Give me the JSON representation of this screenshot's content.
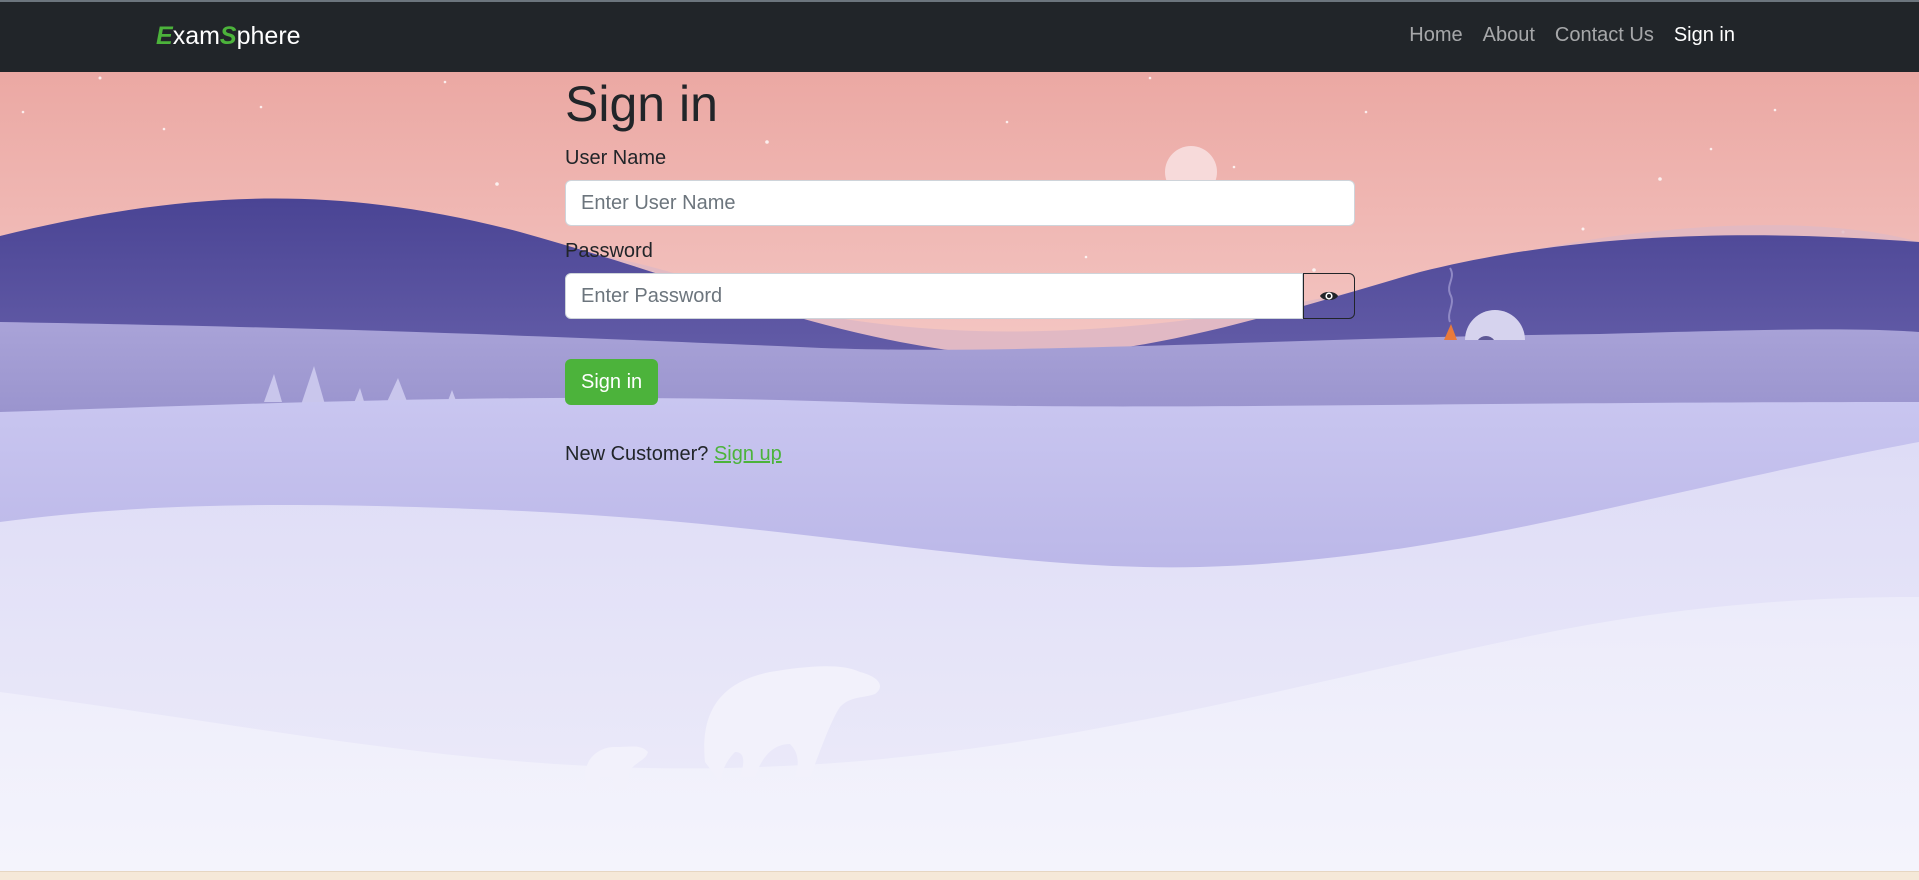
{
  "navbar": {
    "brand": {
      "letter1": "E",
      "part1": "xam",
      "letter2": "S",
      "part2": "phere"
    },
    "links": [
      {
        "label": "Home",
        "active": false
      },
      {
        "label": "About",
        "active": false
      },
      {
        "label": "Contact Us",
        "active": false
      },
      {
        "label": "Sign in",
        "active": true
      }
    ]
  },
  "form": {
    "title": "Sign in",
    "username": {
      "label": "User Name",
      "placeholder": "Enter User Name",
      "value": ""
    },
    "password": {
      "label": "Password",
      "placeholder": "Enter Password",
      "value": ""
    },
    "toggle_icon": "eye-icon",
    "submit_label": "Sign in",
    "new_customer_text": "New Customer?",
    "signup_link": "Sign up"
  },
  "colors": {
    "navbar_bg": "#212529",
    "accent": "#4cb33b",
    "sky_top": "#eaa9a4",
    "hills": "#4c4796",
    "snow": "#eceaf8"
  }
}
